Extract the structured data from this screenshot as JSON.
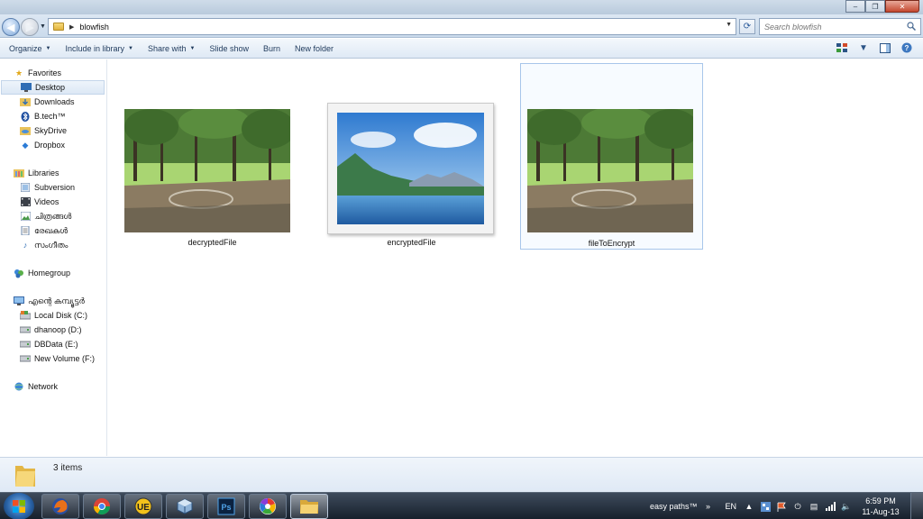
{
  "window": {
    "minimize_label": "–",
    "maximize_label": "❐",
    "close_label": "✕"
  },
  "address": {
    "path": "blowfish",
    "search_placeholder": "Search blowfish"
  },
  "toolbar": {
    "organize": "Organize",
    "include_in_library": "Include in library",
    "share_with": "Share with",
    "slide_show": "Slide show",
    "burn": "Burn",
    "new_folder": "New folder"
  },
  "sidebar": {
    "favorites": "Favorites",
    "favorites_items": [
      "Desktop",
      "Downloads",
      "B.tech™",
      "SkyDrive",
      "Dropbox"
    ],
    "libraries": "Libraries",
    "libraries_items": [
      "Subversion",
      "Videos",
      "ചിത്രങ്ങൾ",
      "രേഖകൾ",
      "സംഗീതം"
    ],
    "homegroup": "Homegroup",
    "computer": "എന്റെ കമ്പ്യൂട്ടർ",
    "computer_items": [
      "Local Disk (C:)",
      "dhanoop (D:)",
      "DBData (E:)",
      "New Volume (F:)"
    ],
    "network": "Network"
  },
  "files": [
    {
      "name": "decryptedFile",
      "thumbnail": "forest-clearing"
    },
    {
      "name": "encryptedFile",
      "thumbnail": "lake-mountains"
    },
    {
      "name": "fileToEncrypt",
      "thumbnail": "forest-clearing"
    }
  ],
  "status": {
    "item_count": "3 items"
  },
  "taskbar": {
    "language": "EN",
    "easy_paths": "easy paths™",
    "time": "6:59 PM",
    "date": "11-Aug-13"
  },
  "colors": {
    "selection_border": "#a8c6ea",
    "taskbar_bg": "#17202c",
    "toolbar_text": "#1e395b"
  }
}
